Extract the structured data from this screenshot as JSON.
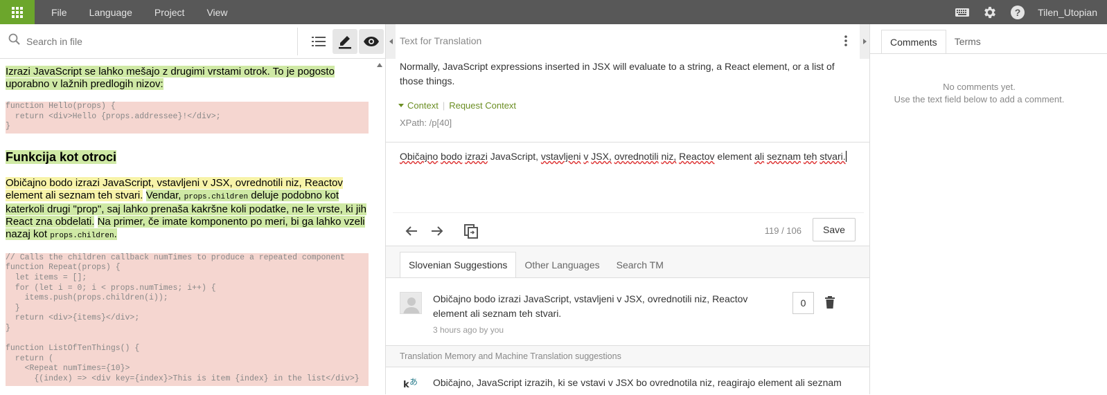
{
  "topbar": {
    "menu": [
      "File",
      "Language",
      "Project",
      "View"
    ],
    "icons": [
      "keyboard-icon",
      "gear-icon",
      "help-icon"
    ],
    "user": "Tilen_Utopian",
    "colors": {
      "bar": "#585858",
      "grid_button": "#6ca62c"
    }
  },
  "left": {
    "search": {
      "placeholder": "Search in file"
    },
    "doc": {
      "p1": "Izrazi JavaScript se lahko mešajo z drugimi vrstami otrok. To je pogosto uporabno v lažnih predlogih nizov:",
      "code1": "function Hello(props) {\n  return <div>Hello {props.addressee}!</div>;\n}",
      "heading": "Funkcija kot otroci",
      "p2_seg1": "Običajno bodo izrazi JavaScript, vstavljeni v JSX, ovrednotili niz, Reactov element ali seznam teh stvari.",
      "p2_seg2a": "Vendar,",
      "p2_code1": "props.children",
      "p2_seg2b": "deluje podobno kot katerkoli drugi \"prop\", saj lahko prenaša kakršne koli podatke, ne le vrste, ki jih React zna obdelati.",
      "p2_seg3a": "Na primer, če imate komponento po meri, bi ga lahko vzeli nazaj kot",
      "p2_code2": "props.children",
      "p2_seg3b": ".",
      "code2": "// Calls the children callback numTimes to produce a repeated component\nfunction Repeat(props) {\n  let items = [];\n  for (let i = 0; i < props.numTimes; i++) {\n    items.push(props.children(i));\n  }\n  return <div>{items}</div>;\n}\n\nfunction ListOfTenThings() {\n  return (\n    <Repeat numTimes={10}>\n      {(index) => <div key={index}>This is item {index} in the list</div>}"
    }
  },
  "mid": {
    "source_header": "Text for Translation",
    "source_text": "Normally, JavaScript expressions inserted in JSX will evaluate to a string, a React element, or a list of those things.",
    "context_label": "Context",
    "request_context": "Request Context",
    "xpath": "XPath: /p[40]",
    "translation": {
      "w1": "Običajno",
      "w2": "bodo",
      "w3": "izrazi",
      "w4": "JavaScript,",
      "w5": "vstavljeni",
      "w6": "v",
      "w7": "JSX,",
      "w8": "ovrednotili",
      "w9": "niz,",
      "w10": "Reactov",
      "w11": "element",
      "w12": "ali",
      "w13": "seznam",
      "w14": "teh",
      "w15": "stvari."
    },
    "counter": "119 / 106",
    "save_label": "Save",
    "tabs": [
      "Slovenian Suggestions",
      "Other Languages",
      "Search TM"
    ],
    "suggestion": {
      "text": "Običajno bodo izrazi JavaScript, vstavljeni v JSX, ovrednotili niz, Reactov element ali seznam teh stvari.",
      "meta": "3 hours ago by you",
      "votes": "0"
    },
    "tm_header": "Translation Memory and Machine Translation suggestions",
    "tm_text": "Običajno, JavaScript izrazih, ki se vstavi v JSX bo ovrednotila niz, reagirajo element ali seznam"
  },
  "right": {
    "tabs": [
      "Comments",
      "Terms"
    ],
    "empty_line1": "No comments yet.",
    "empty_line2": "Use the text field below to add a comment."
  }
}
